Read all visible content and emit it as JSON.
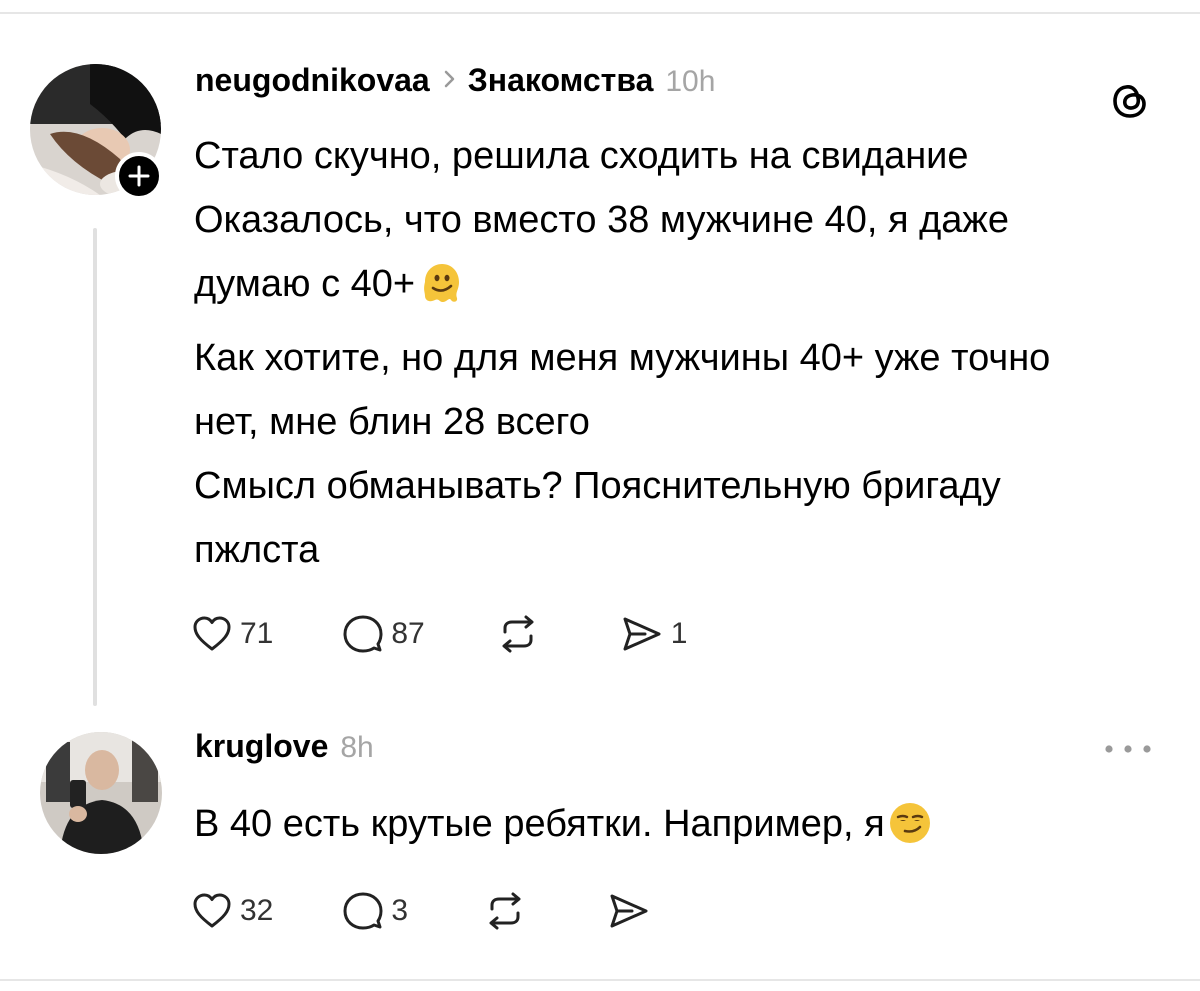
{
  "posts": [
    {
      "username": "neugodnikovaa",
      "topic": "Знакомства",
      "time": "10h",
      "lines": [
        "Стало скучно, решила сходить на свидание",
        "Оказалось, что вместо 38 мужчине 40, я даже думаю с 40+",
        "Как хотите, но для меня мужчины 40+ уже точно нет, мне блин 28 всего",
        "Смысл обманывать? Пояснительную бригаду пжлста"
      ],
      "emoji": "melting-face-emoji",
      "likes": "71",
      "replies": "87",
      "shares": "1"
    },
    {
      "username": "kruglove",
      "time": "8h",
      "text": "В 40 есть крутые ребятки. Например, я",
      "emoji": "smirking-face-emoji",
      "likes": "32",
      "replies": "3"
    }
  ],
  "icons": {
    "like": "heart-icon",
    "reply": "comment-bubble-icon",
    "repost": "repost-icon",
    "share": "send-icon",
    "brand": "threads-logo-icon",
    "more": "more-options-icon",
    "follow": "plus-icon",
    "separator": "chevron-right-icon"
  },
  "colors": {
    "text": "#000000",
    "muted": "#a5a5a5",
    "thread_line": "#e0e0e0"
  }
}
